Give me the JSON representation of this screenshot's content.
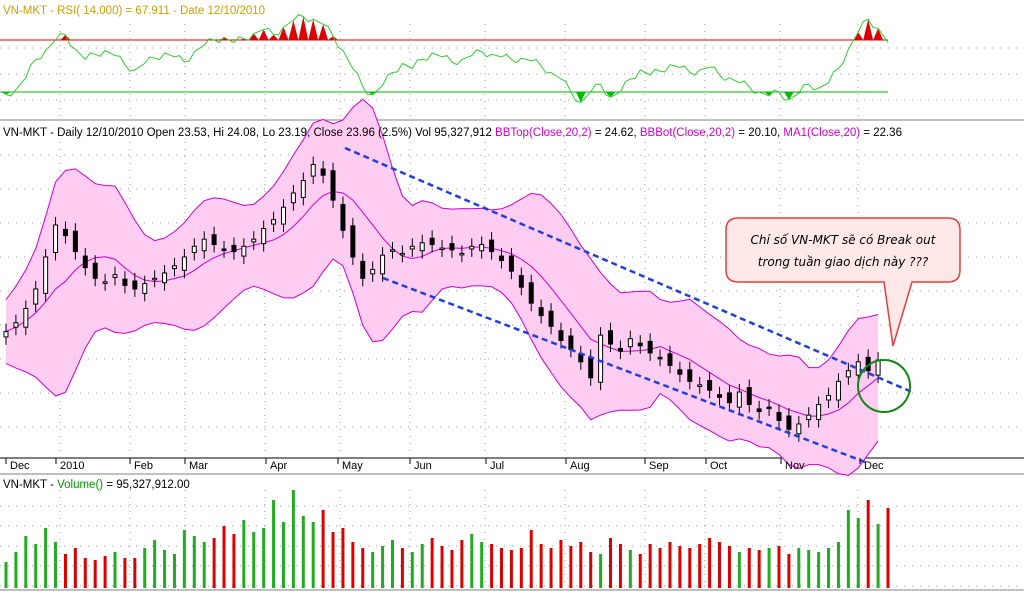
{
  "rsi_panel": {
    "label_parts": [
      "VN-MKT - ",
      "RSI( ",
      "14.000",
      ") = ",
      "67.911",
      " - Date ",
      "12/10/2010"
    ],
    "colors": {
      "line": "#33cc33",
      "upper": "#e00000",
      "lower": "#00bb00",
      "title": "#c8a000"
    }
  },
  "price_panel": {
    "label_parts": [
      {
        "t": "VN-MKT - Daily 12/10/2010 Open 23.53, Hi 24.08, Lo 23.19, Close 23.96 (2.5%) Vol 95,327,912 ",
        "c": "#000000"
      },
      {
        "t": "BBTop(Close,20,2)",
        "c": "#cc00cc"
      },
      {
        "t": " = 24.62, ",
        "c": "#000000"
      },
      {
        "t": "BBBot(Close,20,2)",
        "c": "#cc00cc"
      },
      {
        "t": " = 20.10, ",
        "c": "#000000"
      },
      {
        "t": "MA1(Close,20)",
        "c": "#cc00cc"
      },
      {
        "t": " = 22.36",
        "c": "#000000"
      }
    ]
  },
  "volume_panel": {
    "label_parts": [
      {
        "t": "VN-MKT - ",
        "c": "#000000"
      },
      {
        "t": "Volume()",
        "c": "#009900"
      },
      {
        "t": " = 95,327,912.00",
        "c": "#000000"
      }
    ]
  },
  "x_axis": {
    "months": [
      "Dec",
      "2010",
      "Feb",
      "Mar",
      "Apr",
      "May",
      "Jun",
      "Jul",
      "Aug",
      "Sep",
      "Oct",
      "Nov",
      "Dec"
    ]
  },
  "annotation": {
    "lines": [
      "Chỉ số VN-MKT sẽ có Break out",
      "trong tuần giao dịch này ???"
    ]
  },
  "colors": {
    "band_fill": "#ffccf2",
    "band_line": "#cc00cc",
    "trend_line": "#1f3fd8",
    "circle": "#118811",
    "candle": "#000000",
    "vol_up": "#22aa22",
    "vol_down": "#dd0000"
  },
  "chart_data": [
    {
      "type": "line",
      "title": "RSI(14.000)",
      "series": [
        {
          "name": "RSI",
          "values": [
            28,
            32,
            41,
            55,
            62,
            70,
            74,
            63,
            55,
            59,
            62,
            58,
            51,
            47,
            52,
            56,
            60,
            57,
            53,
            61,
            66,
            70,
            72,
            68,
            71,
            75,
            78,
            74,
            80,
            85,
            88,
            86,
            82,
            73,
            62,
            48,
            34,
            28,
            35,
            45,
            52,
            48,
            55,
            60,
            57,
            53,
            55,
            58,
            61,
            59,
            57,
            55,
            56,
            54,
            50,
            45,
            40,
            30,
            22,
            30,
            36,
            26,
            30,
            40,
            47,
            43,
            46,
            51,
            49,
            45,
            47,
            49,
            43,
            41,
            37,
            34,
            30,
            27,
            30,
            24,
            29,
            36,
            33,
            37,
            48,
            63,
            76,
            86,
            79,
            68
          ]
        }
      ],
      "levels": [
        30,
        70
      ],
      "last_value": 67.911
    },
    {
      "type": "candlestick",
      "title": "VN-MKT - Daily",
      "ylabel": "",
      "series": [
        {
          "name": "Close",
          "values": [
            20.0,
            20.5,
            21.3,
            22.4,
            24.2,
            26.0,
            25.4,
            24.5,
            23.6,
            23.0,
            22.8,
            23.2,
            22.6,
            22.4,
            22.7,
            23.0,
            23.3,
            23.7,
            24.2,
            24.8,
            25.2,
            24.9,
            24.6,
            24.5,
            24.8,
            25.2,
            25.8,
            26.3,
            27.0,
            27.8,
            28.5,
            29.4,
            28.8,
            27.4,
            25.7,
            24.2,
            23.0,
            23.5,
            24.3,
            24.6,
            24.4,
            24.8,
            25.0,
            24.9,
            24.7,
            24.6,
            24.4,
            24.8,
            24.9,
            24.5,
            24.0,
            23.4,
            22.5,
            21.6,
            20.9,
            20.3,
            19.5,
            19.0,
            18.3,
            17.4,
            19.8,
            19.3,
            18.9,
            19.6,
            19.2,
            18.8,
            18.5,
            18.1,
            17.6,
            17.2,
            17.0,
            16.7,
            16.3,
            16.0,
            16.6,
            15.9,
            15.5,
            15.7,
            15.0,
            14.5,
            14.8,
            15.3,
            15.9,
            16.4,
            17.2,
            17.8,
            18.3,
            17.8,
            18.4
          ]
        }
      ],
      "months": [
        "Dec",
        "2010",
        "Feb",
        "Mar",
        "Apr",
        "May",
        "Jun",
        "Jul",
        "Aug",
        "Sep",
        "Oct",
        "Nov",
        "Dec"
      ],
      "last": {
        "date": "12/10/2010",
        "open": 23.53,
        "high": 24.08,
        "low": 23.19,
        "close": 23.96,
        "change_pct": 2.5,
        "volume": 95327912
      },
      "indicators": {
        "BBTop(Close,20,2)": 24.62,
        "BBBot(Close,20,2)": 20.1,
        "MA1(Close,20)": 22.36
      }
    },
    {
      "type": "bar",
      "title": "Volume()",
      "series": [
        {
          "name": "Volume",
          "values": [
            26,
            36,
            52,
            44,
            60,
            46,
            34,
            40,
            30,
            28,
            32,
            36,
            30,
            30,
            40,
            48,
            38,
            34,
            58,
            52,
            46,
            50,
            62,
            54,
            68,
            56,
            60,
            88,
            66,
            98,
            72,
            66,
            78,
            56,
            60,
            46,
            40,
            36,
            42,
            48,
            40,
            36,
            44,
            50,
            42,
            38,
            48,
            54,
            46,
            44,
            40,
            38,
            40,
            58,
            44,
            40,
            48,
            42,
            46,
            36,
            34,
            50,
            44,
            38,
            34,
            44,
            40,
            46,
            42,
            40,
            44,
            50,
            46,
            42,
            36,
            40,
            38,
            40,
            42,
            34,
            40,
            38,
            36,
            40,
            46,
            78,
            70,
            88,
            64,
            80
          ]
        }
      ],
      "last_value": 95327912.0
    }
  ]
}
